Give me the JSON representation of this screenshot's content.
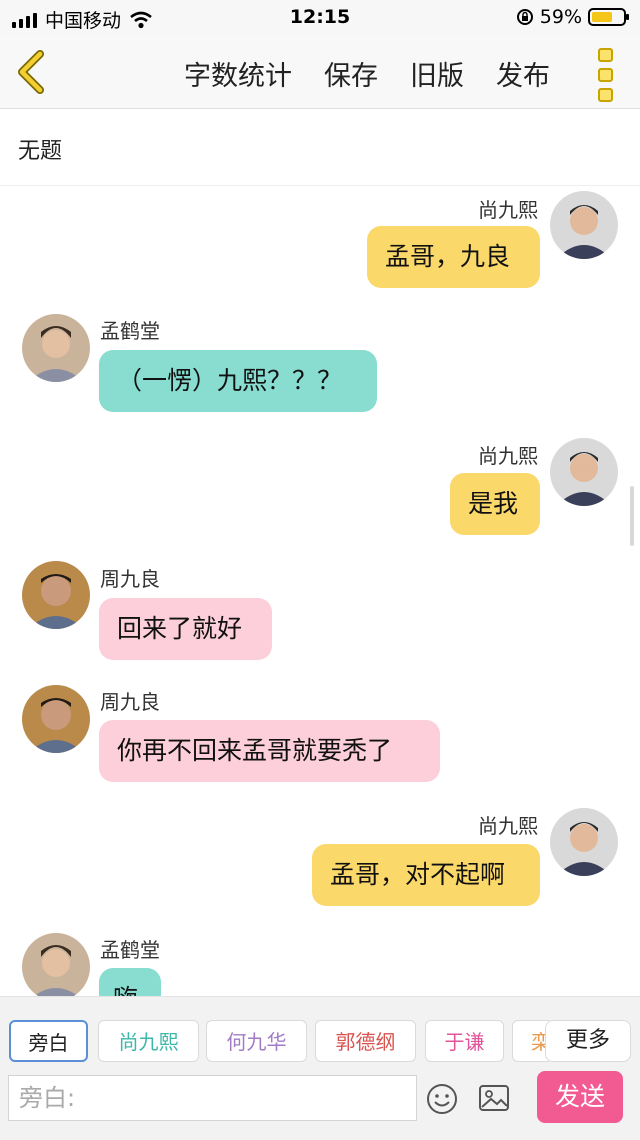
{
  "status_bar": {
    "carrier": "中国移动",
    "time": "12:15",
    "battery": "59%"
  },
  "toolbar": {
    "word_count": "字数统计",
    "save": "保存",
    "old_version": "旧版",
    "publish": "发布"
  },
  "document_title": "无题",
  "messages": [
    {
      "sender": "尚九熙",
      "text": "孟哥，九良",
      "side": "right",
      "color": "#fbd86a"
    },
    {
      "sender": "孟鹤堂",
      "text": "（一愣）九熙？？？",
      "side": "left",
      "color": "#88dcd0"
    },
    {
      "sender": "尚九熙",
      "text": "是我",
      "side": "right",
      "color": "#fbd86a"
    },
    {
      "sender": "周九良",
      "text": "回来了就好",
      "side": "left",
      "color": "#fccfdb"
    },
    {
      "sender": "周九良",
      "text": "你再不回来孟哥就要秃了",
      "side": "left",
      "color": "#fccfdb"
    },
    {
      "sender": "尚九熙",
      "text": "孟哥，对不起啊",
      "side": "right",
      "color": "#fbd86a"
    },
    {
      "sender": "孟鹤堂",
      "text": "嗨",
      "side": "left",
      "color": "#88dcd0"
    }
  ],
  "role_chips": [
    {
      "label": "旁白",
      "color": "#222222"
    },
    {
      "label": "尚九熙",
      "color": "#3cb7a9"
    },
    {
      "label": "何九华",
      "color": "#a07cc7"
    },
    {
      "label": "郭德纲",
      "color": "#d9534f"
    },
    {
      "label": "于谦",
      "color": "#e0569a"
    },
    {
      "label": "栾",
      "color": "#e89a50"
    }
  ],
  "more_label": "更多",
  "input": {
    "placeholder": "旁白:"
  },
  "send_label": "发送",
  "icons": {
    "back": "chevron-left-icon",
    "menu": "more-vertical-icon",
    "emoji": "smiley-icon",
    "image": "image-icon"
  }
}
